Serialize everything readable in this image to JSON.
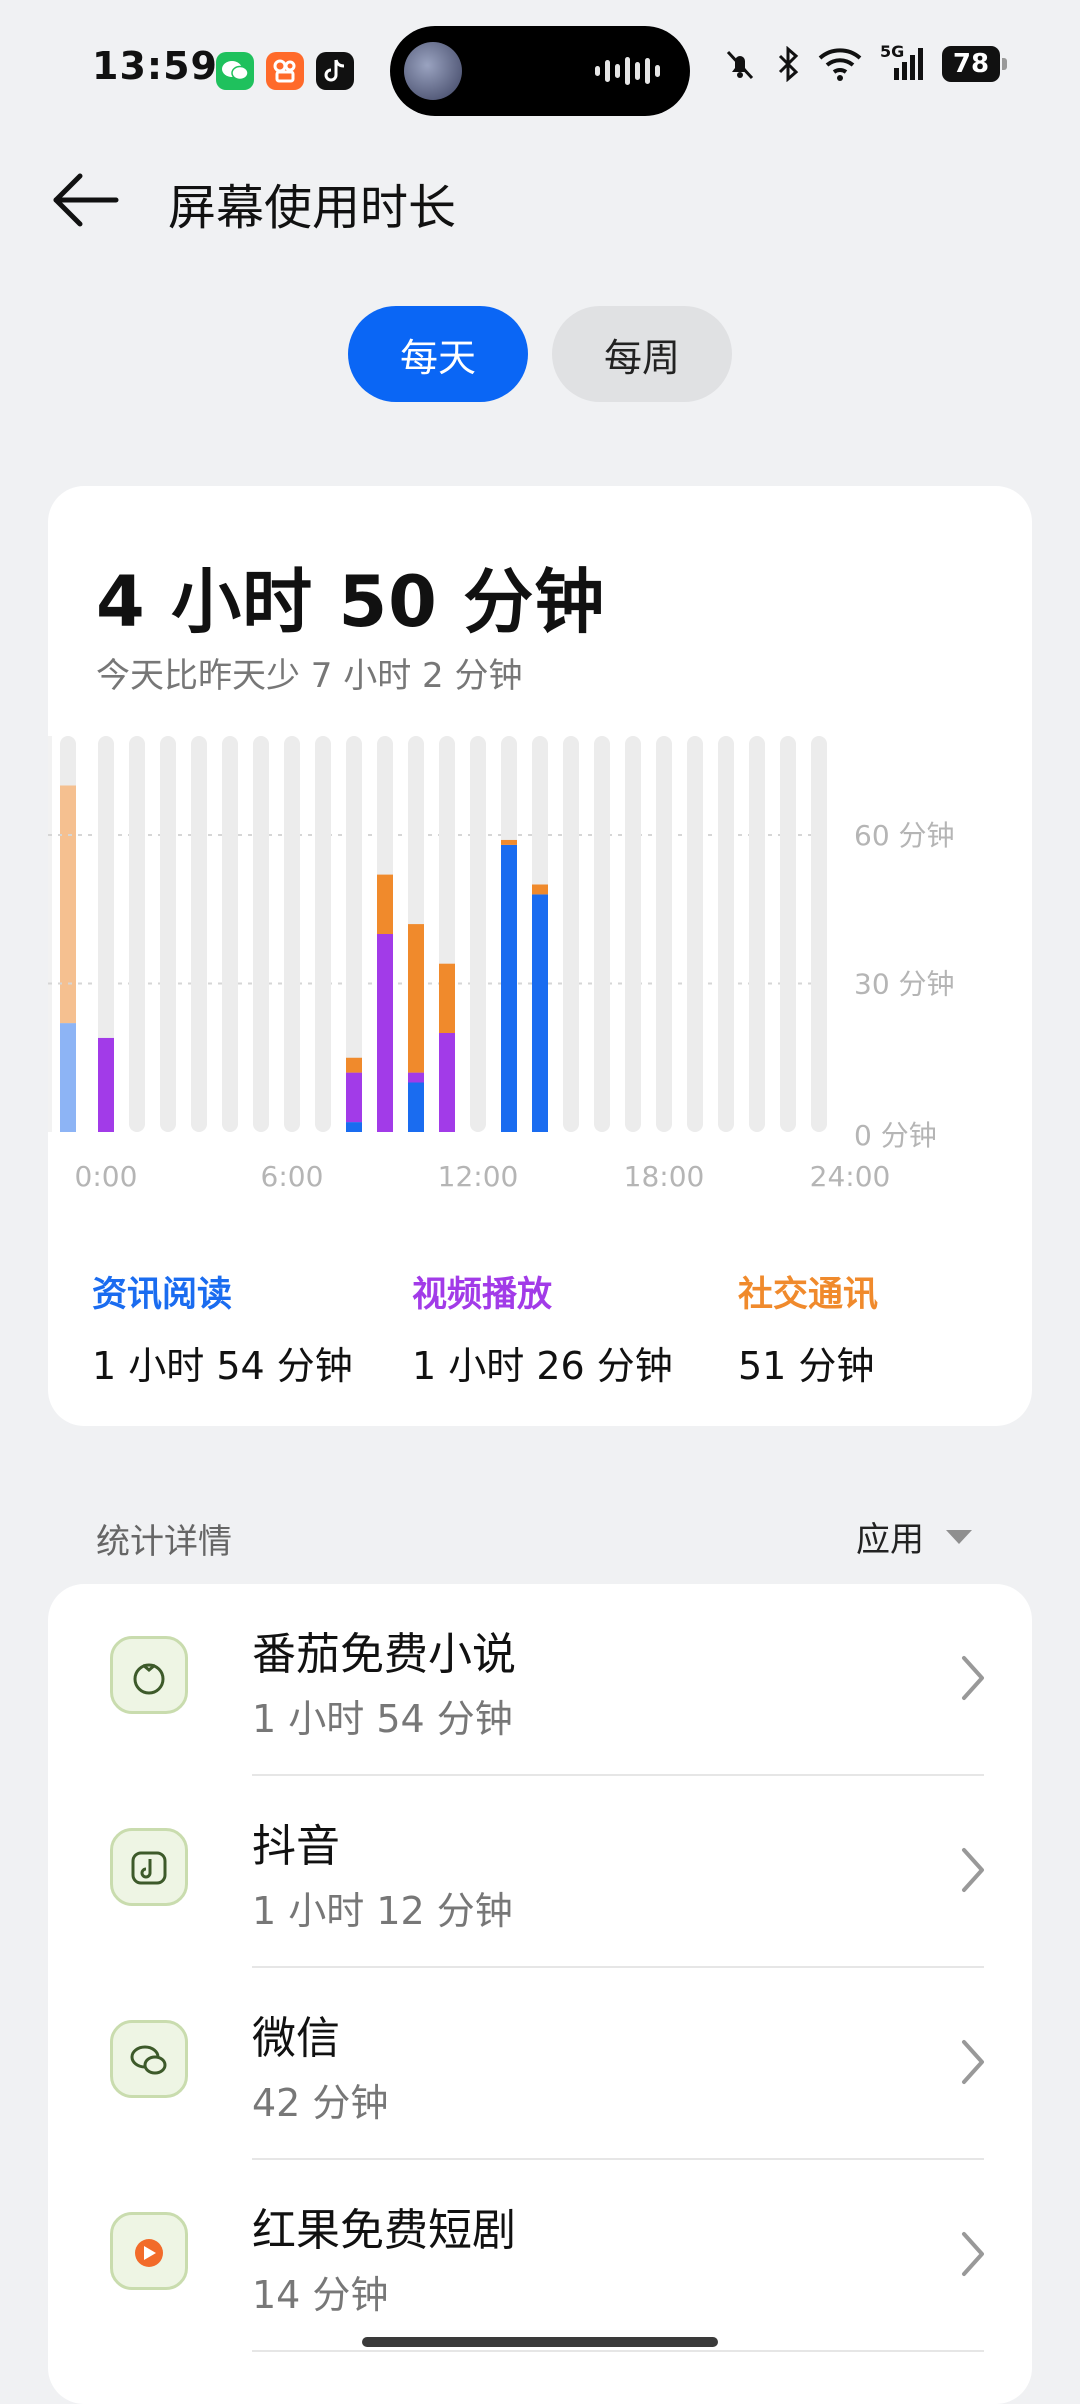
{
  "status_bar": {
    "time": "13:59",
    "notifications": [
      "wechat-icon",
      "kuaishou-icon",
      "douyin-icon"
    ],
    "signal_label": "5G",
    "battery": "78"
  },
  "header": {
    "title": "屏幕使用时长"
  },
  "tabs": {
    "day": "每天",
    "week": "每周",
    "selected": "每天"
  },
  "summary": {
    "total": "4 小时 50 分钟",
    "compare": "今天比昨天少 7 小时 2 分钟"
  },
  "chart_data": {
    "type": "bar",
    "stacked": true,
    "x_unit": "hour",
    "x_ticks": [
      "0:00",
      "6:00",
      "12:00",
      "18:00",
      "24:00"
    ],
    "y_ticks": [
      "0 分钟",
      "30 分钟",
      "60 分钟"
    ],
    "ylim": [
      0,
      80
    ],
    "grid": "horizontal dashed at 30 and 60",
    "series": [
      {
        "name": "资讯阅读",
        "color": "#1a6cf0",
        "values": [
          0,
          0,
          0,
          0,
          0,
          0,
          0,
          0,
          2,
          0,
          10,
          0,
          0,
          58,
          48,
          0,
          0,
          0,
          0,
          0,
          0,
          0,
          0,
          0
        ]
      },
      {
        "name": "视频播放",
        "color": "#a23be8",
        "values": [
          19,
          0,
          0,
          0,
          0,
          0,
          0,
          0,
          10,
          40,
          2,
          20,
          0,
          0,
          0,
          0,
          0,
          0,
          0,
          0,
          0,
          0,
          0,
          0
        ]
      },
      {
        "name": "社交通讯",
        "color": "#f08a2c",
        "values": [
          0,
          0,
          0,
          0,
          0,
          0,
          0,
          0,
          3,
          12,
          30,
          14,
          0,
          1,
          2,
          0,
          0,
          0,
          0,
          0,
          0,
          0,
          0,
          0
        ]
      }
    ],
    "prior_partial_bar": {
      "资讯阅读": 22,
      "社交通讯": 48
    }
  },
  "legend": [
    {
      "label": "资讯阅读",
      "value": "1 小时 54 分钟",
      "color": "#1a6cf0"
    },
    {
      "label": "视频播放",
      "value": "1 小时 26 分钟",
      "color": "#a23be8"
    },
    {
      "label": "社交通讯",
      "value": "51 分钟",
      "color": "#f08a2c"
    }
  ],
  "details": {
    "title": "统计详情",
    "sort_label": "应用",
    "apps": [
      {
        "name": "番茄免费小说",
        "time": "1 小时 54 分钟",
        "icon": "tomato-novel-icon"
      },
      {
        "name": "抖音",
        "time": "1 小时 12 分钟",
        "icon": "douyin-app-icon"
      },
      {
        "name": "微信",
        "time": "42 分钟",
        "icon": "wechat-app-icon"
      },
      {
        "name": "红果免费短剧",
        "time": "14 分钟",
        "icon": "hongguo-drama-icon"
      }
    ]
  }
}
